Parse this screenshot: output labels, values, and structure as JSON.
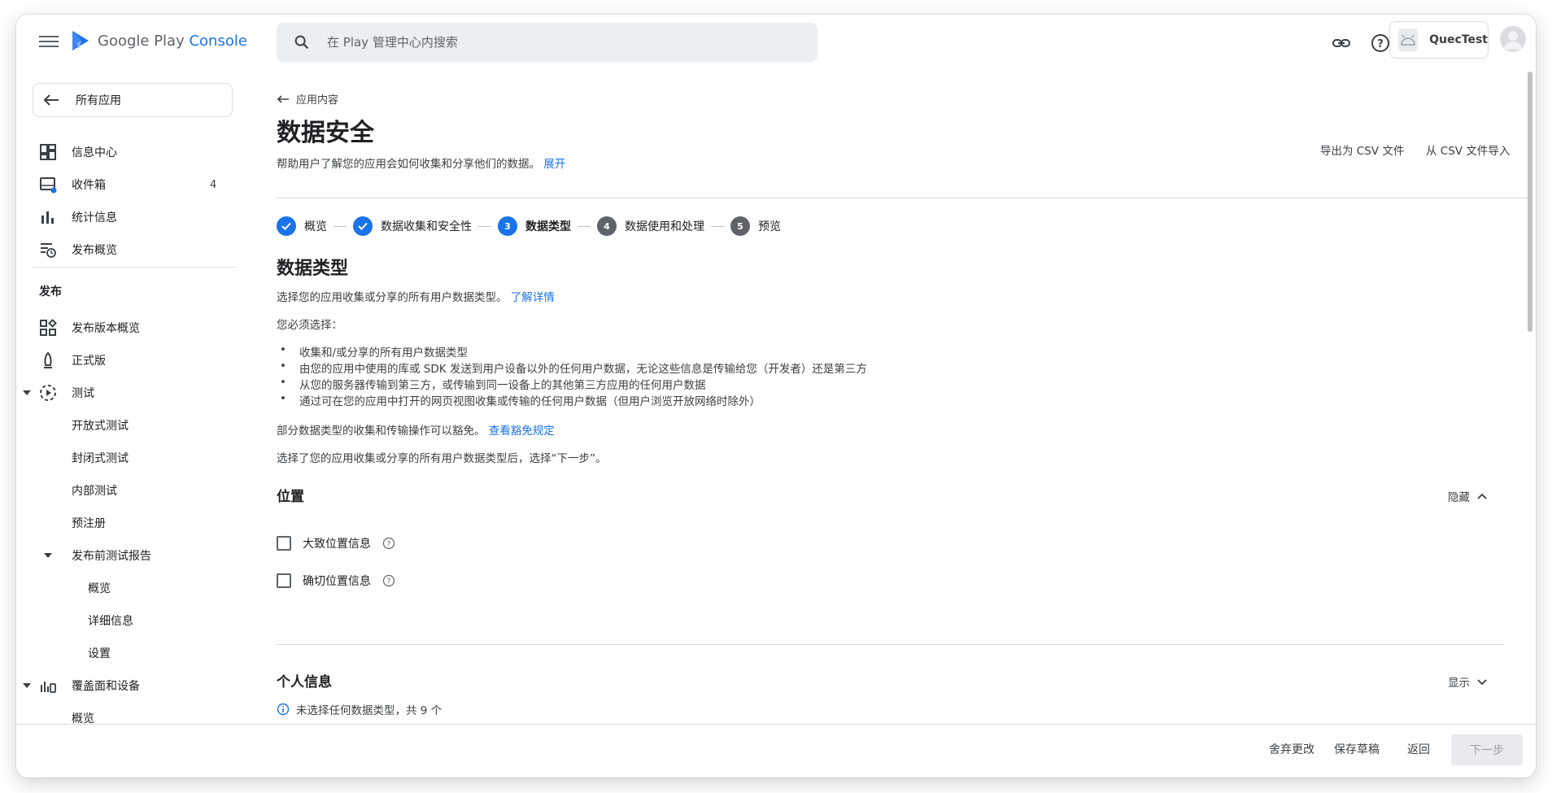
{
  "app": {
    "logo_text_main": "Google Play",
    "logo_text_accent": "Console",
    "search_placeholder": "在 Play 管理中心内搜索",
    "account_name": "QuecTest"
  },
  "sidebar": {
    "all_apps": "所有应用",
    "top_items": [
      {
        "label": "信息中心",
        "icon": "dashboard-icon"
      },
      {
        "label": "收件箱",
        "icon": "inbox-icon",
        "count": "4"
      },
      {
        "label": "统计信息",
        "icon": "bar-chart-icon"
      },
      {
        "label": "发布概览",
        "icon": "publish-overview-icon"
      }
    ],
    "section_release": "发布",
    "release_items": {
      "release_overview": "发布版本概览",
      "production": "正式版",
      "testing": "测试",
      "open_testing": "开放式测试",
      "closed_testing": "封闭式测试",
      "internal_testing": "内部测试",
      "preregistration": "预注册",
      "prelaunch_report": "发布前测试报告",
      "overview": "概览",
      "details": "详细信息",
      "settings": "设置",
      "reach_devices": "覆盖面和设备",
      "reach_overview": "概览"
    }
  },
  "main": {
    "back_label": "应用内容",
    "title": "数据安全",
    "subtitle": "帮助用户了解您的应用会如何收集和分享他们的数据。",
    "expand_link": "展开",
    "export_csv": "导出为 CSV 文件",
    "import_csv": "从 CSV 文件导入",
    "steps": [
      {
        "label": "概览",
        "state": "done",
        "num": ""
      },
      {
        "label": "数据收集和安全性",
        "state": "done",
        "num": ""
      },
      {
        "label": "数据类型",
        "state": "current",
        "num": "3"
      },
      {
        "label": "数据使用和处理",
        "state": "todo",
        "num": "4"
      },
      {
        "label": "预览",
        "state": "todo",
        "num": "5"
      }
    ],
    "section_title": "数据类型",
    "intro": "选择您的应用收集或分享的所有用户数据类型。",
    "learn_more": "了解详情",
    "must_select": "您必须选择：",
    "bullets": [
      "收集和/或分享的所有用户数据类型",
      "由您的应用中使用的库或 SDK 发送到用户设备以外的任何用户数据，无论这些信息是传输给您（开发者）还是第三方",
      "从您的服务器传输到第三方，或传输到同一设备上的其他第三方应用的任何用户数据",
      "通过可在您的应用中打开的网页视图收集或传输的任何用户数据（但用户浏览开放网络时除外）"
    ],
    "exemption_text": "部分数据类型的收集和传输操作可以豁免。",
    "exemption_link": "查看豁免规定",
    "next_instruction": "选择了您的应用收集或分享的所有用户数据类型后，选择“下一步”。",
    "location_group": {
      "title": "位置",
      "toggle": "隐藏",
      "options": [
        "大致位置信息",
        "确切位置信息"
      ]
    },
    "personal_group": {
      "title": "个人信息",
      "toggle": "显示",
      "info": "未选择任何数据类型，共 9 个"
    }
  },
  "footer": {
    "discard": "舍弃更改",
    "save_draft": "保存草稿",
    "back": "返回",
    "next": "下一步"
  }
}
